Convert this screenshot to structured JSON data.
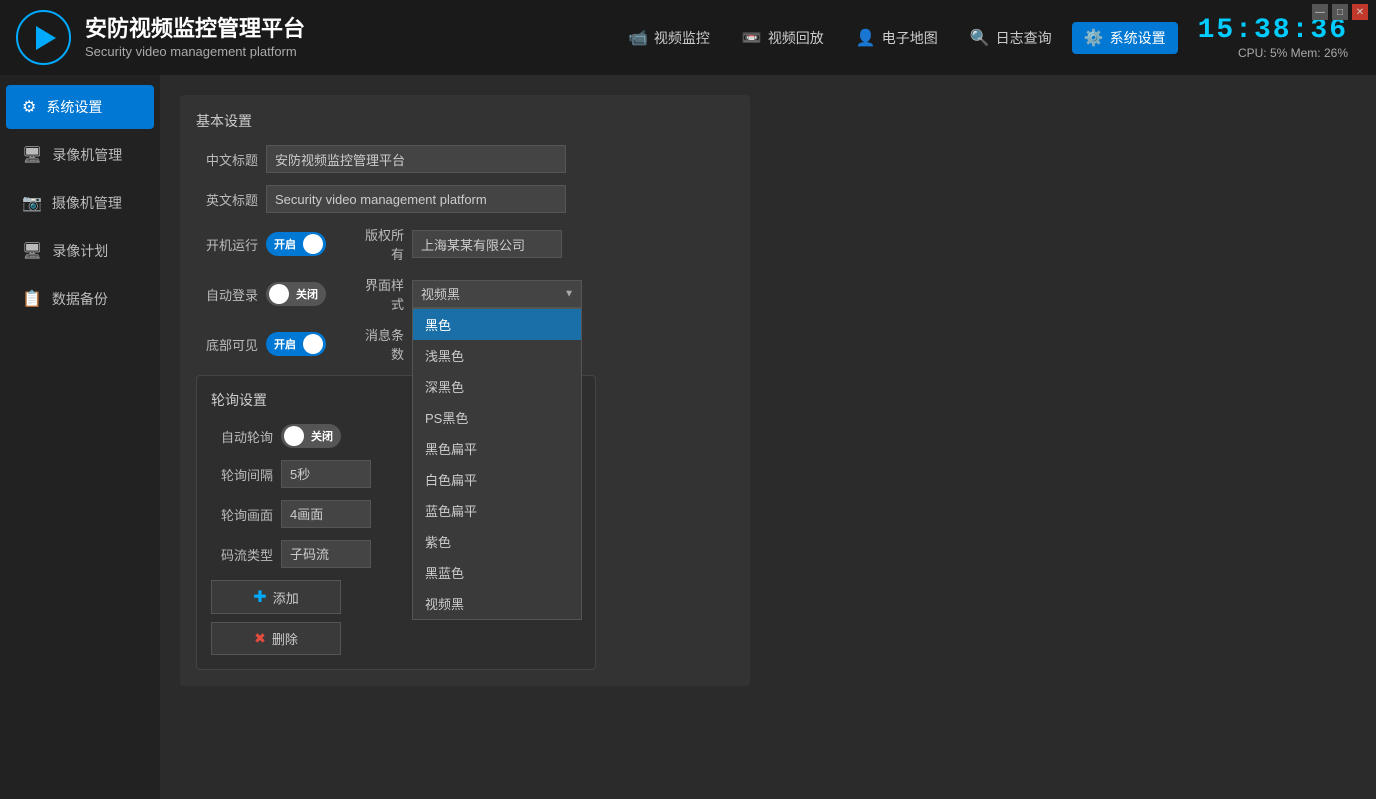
{
  "app": {
    "title_cn": "安防视频监控管理平台",
    "title_en": "Security video management platform",
    "clock": "15:38:36",
    "cpu": "CPU: 5% Mem: 26%"
  },
  "nav": {
    "items": [
      {
        "id": "video-monitor",
        "label": "视频监控",
        "icon": "📹"
      },
      {
        "id": "video-playback",
        "label": "视频回放",
        "icon": "📼"
      },
      {
        "id": "electronic-map",
        "label": "电子地图",
        "icon": "👤"
      },
      {
        "id": "log-query",
        "label": "日志查询",
        "icon": "🔍"
      },
      {
        "id": "system-settings",
        "label": "系统设置",
        "icon": "⚙️",
        "active": true
      }
    ]
  },
  "sidebar": {
    "items": [
      {
        "id": "system-settings",
        "label": "系统设置",
        "icon": "⚙",
        "active": true
      },
      {
        "id": "recorder-management",
        "label": "录像机管理",
        "icon": "🖥"
      },
      {
        "id": "camera-management",
        "label": "摄像机管理",
        "icon": "📷"
      },
      {
        "id": "recording-plan",
        "label": "录像计划",
        "icon": "🖥"
      },
      {
        "id": "data-backup",
        "label": "数据备份",
        "icon": "📋"
      }
    ]
  },
  "settings": {
    "section_basic": "基本设置",
    "label_cn_title": "中文标题",
    "value_cn_title": "安防视频监控管理平台",
    "label_en_title": "英文标题",
    "value_en_title": "Security video management platform",
    "label_startup": "开机运行",
    "startup_on": true,
    "startup_label_on": "开启",
    "startup_label_off": "关闭",
    "label_copyright": "版权所有",
    "value_copyright": "上海某某有限公司",
    "label_auto_login": "自动登录",
    "auto_login_on": false,
    "auto_login_label": "关闭",
    "label_theme": "界面样式",
    "theme_value": "视频黑",
    "label_taskbar": "底部可见",
    "taskbar_on": true,
    "taskbar_label_on": "开启",
    "label_message_count": "消息条数",
    "section_polling": "轮询设置",
    "label_auto_poll": "自动轮询",
    "auto_poll_on": false,
    "auto_poll_label": "关闭",
    "label_poll_interval": "轮询间隔",
    "poll_interval_value": "5秒",
    "label_poll_screens": "轮询画面",
    "poll_screens_value": "4画面",
    "label_stream_type": "码流类型",
    "stream_type_value": "子码流",
    "btn_add": "添加",
    "btn_delete": "删除"
  },
  "dropdown": {
    "options": [
      {
        "id": "black",
        "label": "黑色",
        "selected": true
      },
      {
        "id": "light-black",
        "label": "浅黑色"
      },
      {
        "id": "dark-black",
        "label": "深黑色"
      },
      {
        "id": "ps-black",
        "label": "PS黑色"
      },
      {
        "id": "black-flat",
        "label": "黑色扁平"
      },
      {
        "id": "white-flat",
        "label": "白色扁平"
      },
      {
        "id": "blue-flat",
        "label": "蓝色扁平"
      },
      {
        "id": "purple",
        "label": "紫色"
      },
      {
        "id": "dark-blue",
        "label": "黑蓝色"
      },
      {
        "id": "video-black",
        "label": "视频黑"
      }
    ]
  },
  "winControls": {
    "minimize": "—",
    "maximize": "□",
    "close": "✕"
  }
}
